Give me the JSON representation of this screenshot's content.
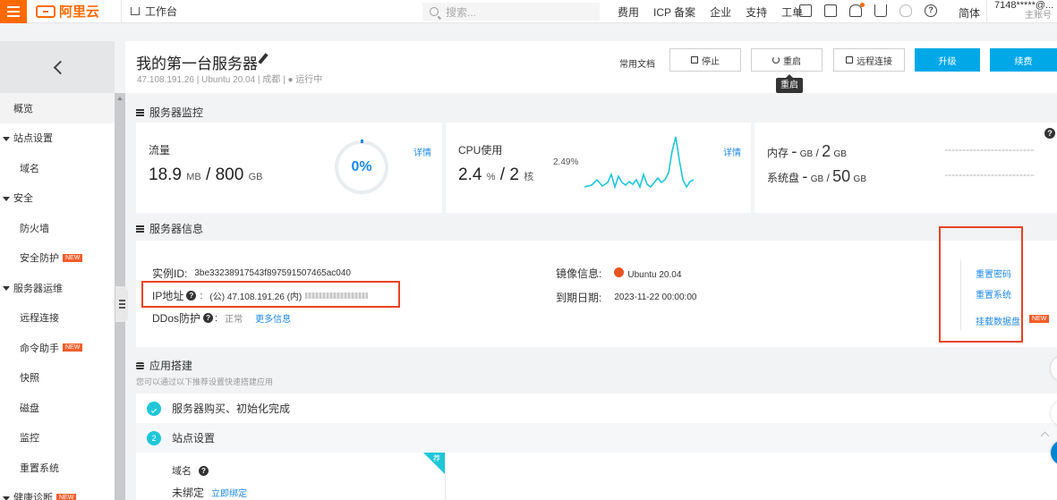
{
  "topbar": {
    "brand": "阿里云",
    "workbench": "工作台",
    "search_placeholder": "搜索...",
    "nav": [
      "费用",
      "ICP 备案",
      "企业",
      "支持",
      "工单"
    ],
    "language": "简体",
    "account_id": "7148*****@...",
    "account_role": "主账号"
  },
  "sidebar": {
    "items": [
      {
        "label": "概览",
        "type": "active"
      },
      {
        "label": "站点设置",
        "type": "group"
      },
      {
        "label": "域名",
        "type": "item"
      },
      {
        "label": "安全",
        "type": "group"
      },
      {
        "label": "防火墙",
        "type": "item"
      },
      {
        "label": "安全防护",
        "type": "item",
        "badge": "NEW"
      },
      {
        "label": "服务器运维",
        "type": "group"
      },
      {
        "label": "远程连接",
        "type": "item"
      },
      {
        "label": "命令助手",
        "type": "item",
        "badge": "NEW"
      },
      {
        "label": "快照",
        "type": "item"
      },
      {
        "label": "磁盘",
        "type": "item"
      },
      {
        "label": "监控",
        "type": "item"
      },
      {
        "label": "重置系统",
        "type": "item"
      },
      {
        "label": "健康诊断",
        "type": "group",
        "badge": "NEW"
      }
    ]
  },
  "header": {
    "title": "我的第一台服务器",
    "meta": "47.108.191.26 | Ubuntu 20.04 | 成都 | ● 运行中",
    "docs": "常用文档",
    "stop": "停止",
    "restart": "重启",
    "remote": "远程连接",
    "upgrade": "升级",
    "renew": "续费",
    "tooltip": "重启"
  },
  "monitor": {
    "section_title": "服务器监控",
    "traffic": {
      "label": "流量",
      "used": "18.9",
      "used_unit": "MB",
      "total": "800",
      "total_unit": "GB",
      "percent": "0%",
      "detail": "详情"
    },
    "cpu": {
      "label": "CPU使用",
      "used": "2.4",
      "used_unit": "%",
      "cores": "2",
      "cores_unit": "核",
      "peak": "2.49%",
      "detail": "详情"
    },
    "memory": {
      "label": "内存",
      "used": "-",
      "used_unit": "GB",
      "total": "2",
      "total_unit": "GB"
    },
    "disk": {
      "label": "系统盘",
      "used": "-",
      "used_unit": "GB",
      "total": "50",
      "total_unit": "GB"
    }
  },
  "info": {
    "section_title": "服务器信息",
    "instance_label": "实例ID:",
    "instance_id": "3be33238917543f897591507465ac040",
    "ip_label": "IP地址",
    "ip_value": "(公) 47.108.191.26 (内)",
    "ddos_label": "DDos防护",
    "ddos_value": "正常",
    "ddos_more": "更多信息",
    "image_label": "镜像信息:",
    "image_value": "Ubuntu 20.04",
    "expire_label": "到期日期:",
    "expire_value": "2023-11-22 00:00:00",
    "actions": [
      "重置密码",
      "重置系统",
      "挂载数据盘"
    ],
    "action_badge": "NEW"
  },
  "app": {
    "section_title": "应用搭建",
    "subtitle": "您可以通过以下推荐设置快速搭建应用",
    "step1": "服务器购买、初始化完成",
    "step2_num": "2",
    "step2": "站点设置",
    "domain_label": "域名",
    "domain_status": "未绑定",
    "bind_now": "立即绑定",
    "corner": "荐"
  },
  "colors": {
    "accent": "#00a8e8",
    "brand": "#ff6a00",
    "link": "#1e88e5",
    "highlight": "#e8431e"
  }
}
